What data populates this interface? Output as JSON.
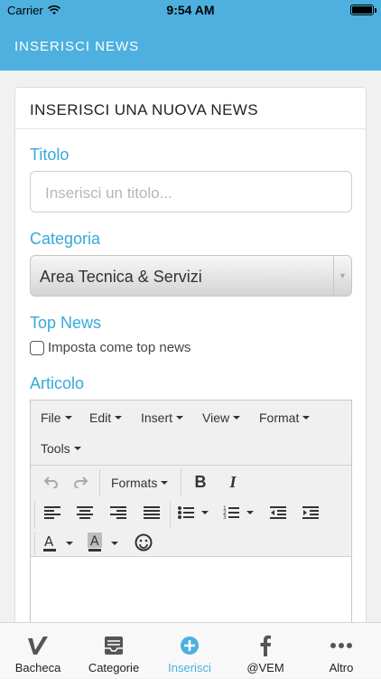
{
  "status": {
    "carrier": "Carrier",
    "time": "9:54 AM"
  },
  "app_bar": {
    "title": "INSERISCI NEWS"
  },
  "card": {
    "heading": "INSERISCI UNA NUOVA NEWS",
    "title_label": "Titolo",
    "title_placeholder": "Inserisci un titolo...",
    "category_label": "Categoria",
    "category_value": "Area Tecnica & Servizi",
    "top_news_label": "Top News",
    "top_news_checkbox": "Imposta come top news",
    "article_label": "Articolo"
  },
  "editor": {
    "menus": [
      "File",
      "Edit",
      "Insert",
      "View",
      "Format",
      "Tools"
    ],
    "formats_label": "Formats"
  },
  "tabs": [
    {
      "label": "Bacheca",
      "icon": "check-icon"
    },
    {
      "label": "Categorie",
      "icon": "inbox-icon"
    },
    {
      "label": "Inserisci",
      "icon": "plus-circle-icon"
    },
    {
      "label": "@VEM",
      "icon": "facebook-icon"
    },
    {
      "label": "Altro",
      "icon": "more-icon"
    }
  ],
  "colors": {
    "accent": "#4db0df",
    "label": "#35a9d8"
  }
}
